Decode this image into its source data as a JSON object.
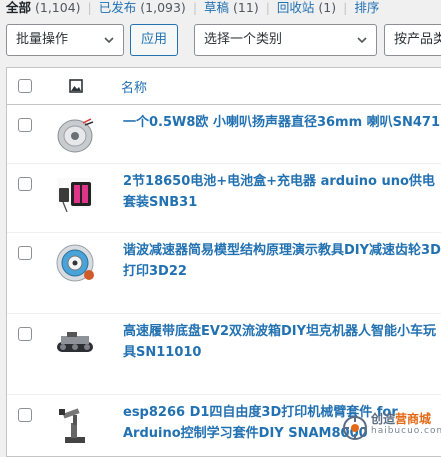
{
  "status_filters": [
    {
      "label": "全部",
      "count": "(1,104)"
    },
    {
      "label": "已发布",
      "count": "(1,093)"
    },
    {
      "label": "草稿",
      "count": "(11)"
    },
    {
      "label": "回收站",
      "count": "(1)"
    },
    {
      "label": "排序",
      "count": ""
    }
  ],
  "toolbar": {
    "bulk_action_value": "批量操作",
    "apply_label": "应用",
    "category_value": "选择一个类别",
    "type_filter_value": "按产品类"
  },
  "table": {
    "name_header": "名称",
    "products": [
      {
        "title": "一个0.5W8欧 小喇叭扬声器直径36mm 喇叭SN471",
        "thumb_icon": "speaker-thumbnail"
      },
      {
        "title": "2节18650电池+电池盒+充电器 arduino uno供电套装SNB31",
        "thumb_icon": "battery-kit-thumbnail"
      },
      {
        "title": "谐波减速器简易模型结构原理演示教具DIY减速齿轮3D打印3D22",
        "thumb_icon": "harmonic-reducer-thumbnail"
      },
      {
        "title": "高速履带底盘EV2双流波箱DIY坦克机器人智能小车玩具SN11010",
        "thumb_icon": "tank-chassis-thumbnail"
      },
      {
        "title": "esp8266 D1四自由度3D打印机械臂套件 for Arduino控制学习套件DIY SNAM8000",
        "thumb_icon": "robot-arm-thumbnail"
      }
    ]
  },
  "watermark": {
    "brand_prefix": "创造",
    "brand_accent": "营商城",
    "domain": "haibucuo.com"
  },
  "colors": {
    "link": "#2271b1",
    "accent": "#e36a16",
    "background": "#f0f0f1"
  }
}
